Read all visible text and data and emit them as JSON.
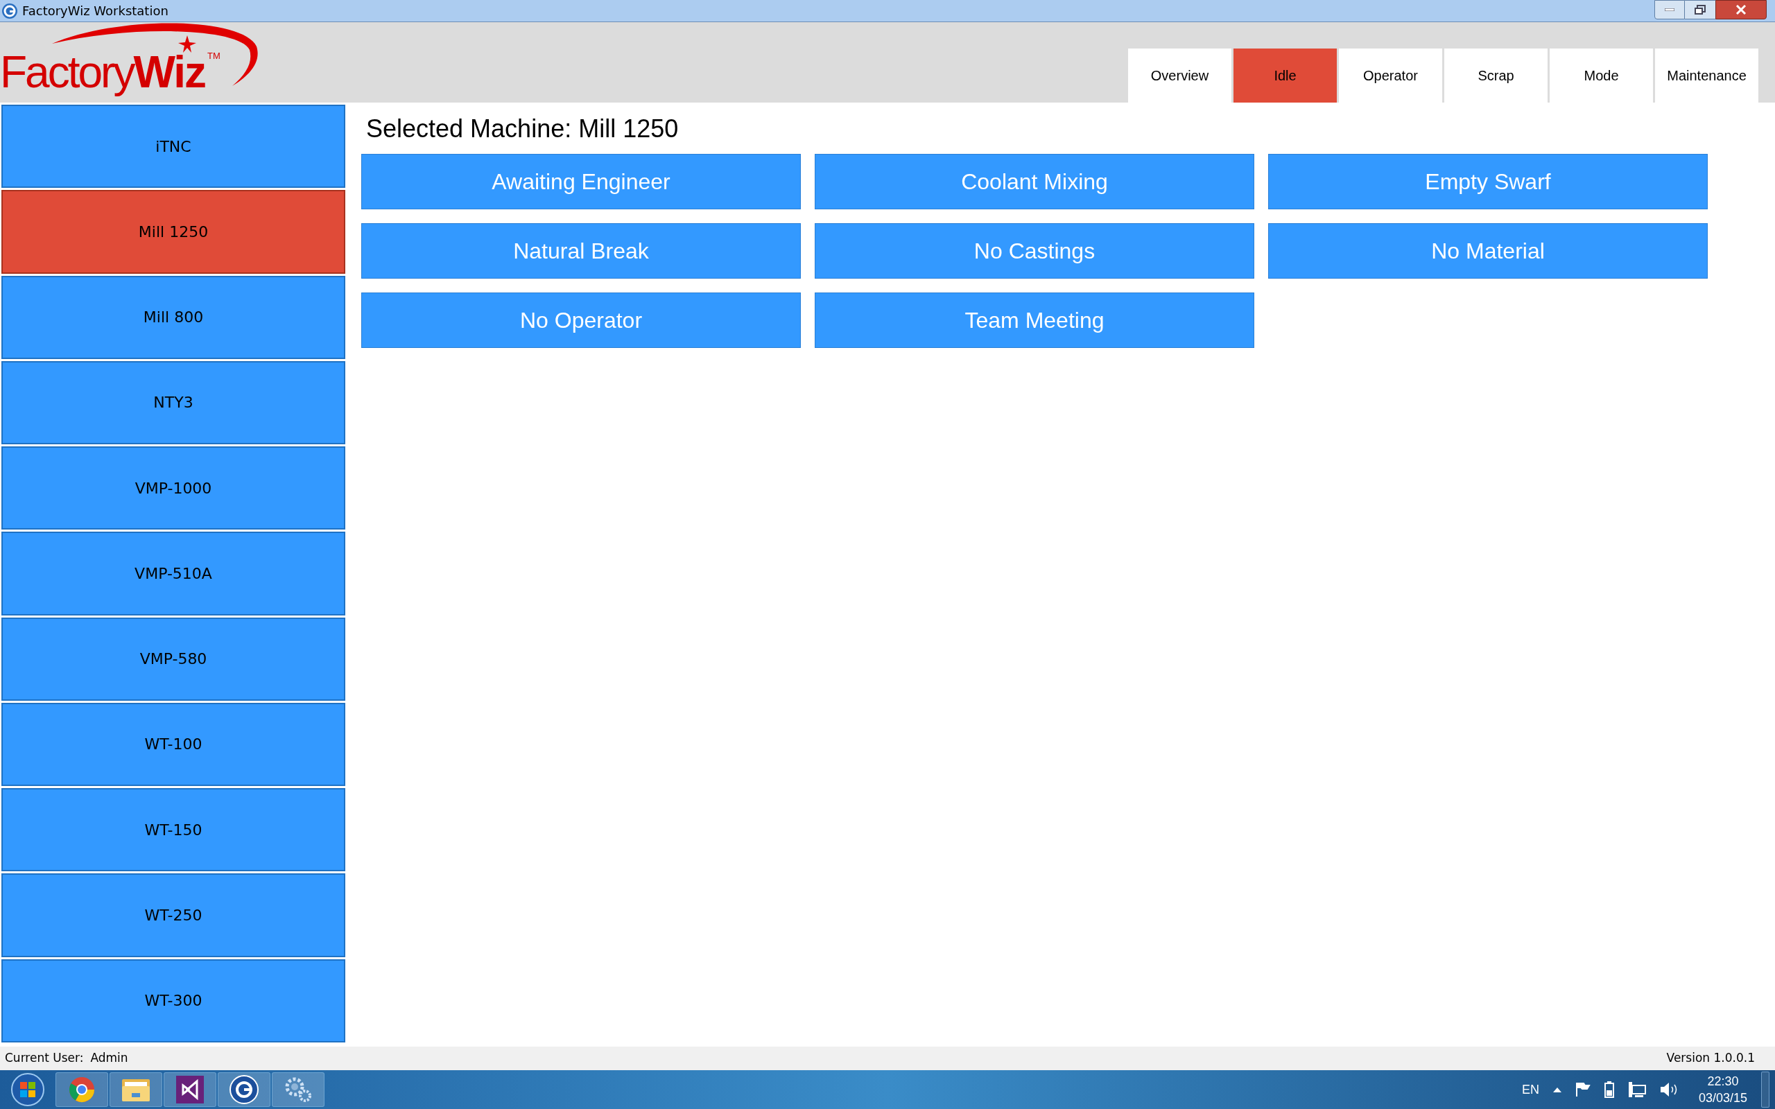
{
  "window": {
    "title": "FactoryWiz Workstation"
  },
  "logo": {
    "word": "Factory",
    "accent": "Wiz",
    "mark": "TM"
  },
  "tabs": [
    {
      "label": "Overview",
      "selected": false
    },
    {
      "label": "Idle",
      "selected": true
    },
    {
      "label": "Operator",
      "selected": false
    },
    {
      "label": "Scrap",
      "selected": false
    },
    {
      "label": "Mode",
      "selected": false
    },
    {
      "label": "Maintenance",
      "selected": false
    }
  ],
  "machines": [
    {
      "label": "iTNC",
      "selected": false
    },
    {
      "label": "Mill 1250",
      "selected": true
    },
    {
      "label": "Mill 800",
      "selected": false
    },
    {
      "label": "NTY3",
      "selected": false
    },
    {
      "label": "VMP-1000",
      "selected": false
    },
    {
      "label": "VMP-510A",
      "selected": false
    },
    {
      "label": "VMP-580",
      "selected": false
    },
    {
      "label": "WT-100",
      "selected": false
    },
    {
      "label": "WT-150",
      "selected": false
    },
    {
      "label": "WT-250",
      "selected": false
    },
    {
      "label": "WT-300",
      "selected": false
    }
  ],
  "heading": "Selected Machine: Mill 1250",
  "reasons": [
    "Awaiting Engineer",
    "Coolant Mixing",
    "Empty Swarf",
    "Natural Break",
    "No Castings",
    "No Material",
    "No Operator",
    "Team Meeting"
  ],
  "status_bar": {
    "user_label": "Current User:",
    "user": "Admin",
    "version": "Version 1.0.0.1"
  },
  "taskbar": {
    "language": "EN",
    "time": "22:30",
    "date": "03/03/15"
  }
}
